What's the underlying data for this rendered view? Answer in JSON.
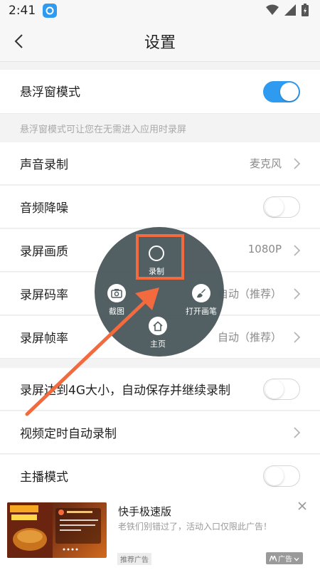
{
  "status_bar": {
    "time": "2:41"
  },
  "header": {
    "title": "设置"
  },
  "settings": {
    "floating_window": {
      "label": "悬浮窗模式",
      "enabled": true
    },
    "hint": "悬浮窗模式可让您在无需进入应用时录屏",
    "audio_recording": {
      "label": "声音录制",
      "value": "麦克风"
    },
    "noise_reduction": {
      "label": "音频降噪",
      "enabled": false
    },
    "quality": {
      "label": "录屏画质",
      "value": "1080P"
    },
    "bitrate": {
      "label": "录屏码率",
      "value": "自动（推荐）"
    },
    "framerate": {
      "label": "录屏帧率",
      "value": "自动（推荐）"
    },
    "autosave": {
      "label": "录屏达到4G大小，自动保存并继续录制",
      "enabled": false
    },
    "scheduled": {
      "label": "视频定时自动录制"
    },
    "streamer": {
      "label": "主播模式",
      "enabled": false
    }
  },
  "floating_menu": {
    "record": "录制",
    "screenshot": "截图",
    "pen": "打开画笔",
    "home": "主页"
  },
  "ad": {
    "title": "快手极速版",
    "description": "老铁们别错过了，活动入口仅限此广告！",
    "badge": "推荐广告",
    "tag": "广告"
  },
  "colors": {
    "accent": "#2f9bf0",
    "highlight": "#f26a3d",
    "menu_bg": "#4d5a5e"
  }
}
